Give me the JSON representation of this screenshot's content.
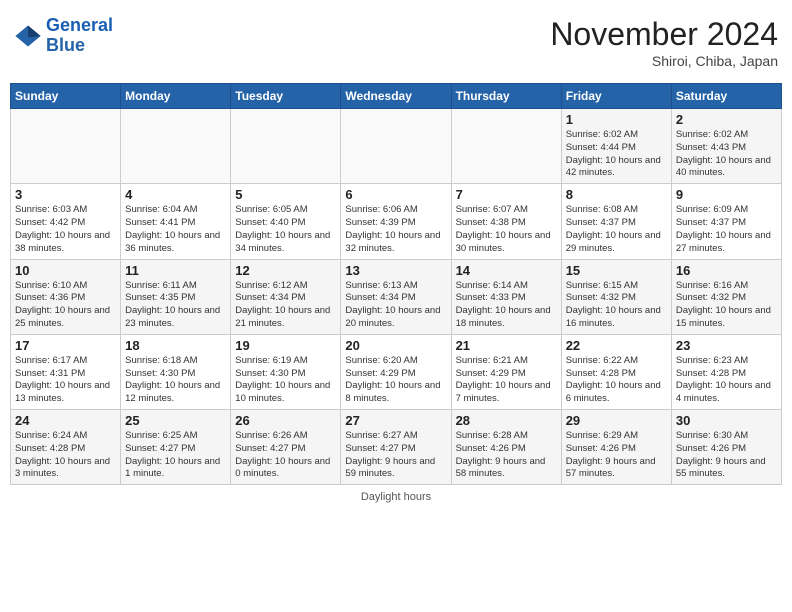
{
  "header": {
    "logo_line1": "General",
    "logo_line2": "Blue",
    "month": "November 2024",
    "location": "Shiroi, Chiba, Japan"
  },
  "days_of_week": [
    "Sunday",
    "Monday",
    "Tuesday",
    "Wednesday",
    "Thursday",
    "Friday",
    "Saturday"
  ],
  "weeks": [
    [
      {
        "day": "",
        "info": ""
      },
      {
        "day": "",
        "info": ""
      },
      {
        "day": "",
        "info": ""
      },
      {
        "day": "",
        "info": ""
      },
      {
        "day": "",
        "info": ""
      },
      {
        "day": "1",
        "info": "Sunrise: 6:02 AM\nSunset: 4:44 PM\nDaylight: 10 hours and 42 minutes."
      },
      {
        "day": "2",
        "info": "Sunrise: 6:02 AM\nSunset: 4:43 PM\nDaylight: 10 hours and 40 minutes."
      }
    ],
    [
      {
        "day": "3",
        "info": "Sunrise: 6:03 AM\nSunset: 4:42 PM\nDaylight: 10 hours and 38 minutes."
      },
      {
        "day": "4",
        "info": "Sunrise: 6:04 AM\nSunset: 4:41 PM\nDaylight: 10 hours and 36 minutes."
      },
      {
        "day": "5",
        "info": "Sunrise: 6:05 AM\nSunset: 4:40 PM\nDaylight: 10 hours and 34 minutes."
      },
      {
        "day": "6",
        "info": "Sunrise: 6:06 AM\nSunset: 4:39 PM\nDaylight: 10 hours and 32 minutes."
      },
      {
        "day": "7",
        "info": "Sunrise: 6:07 AM\nSunset: 4:38 PM\nDaylight: 10 hours and 30 minutes."
      },
      {
        "day": "8",
        "info": "Sunrise: 6:08 AM\nSunset: 4:37 PM\nDaylight: 10 hours and 29 minutes."
      },
      {
        "day": "9",
        "info": "Sunrise: 6:09 AM\nSunset: 4:37 PM\nDaylight: 10 hours and 27 minutes."
      }
    ],
    [
      {
        "day": "10",
        "info": "Sunrise: 6:10 AM\nSunset: 4:36 PM\nDaylight: 10 hours and 25 minutes."
      },
      {
        "day": "11",
        "info": "Sunrise: 6:11 AM\nSunset: 4:35 PM\nDaylight: 10 hours and 23 minutes."
      },
      {
        "day": "12",
        "info": "Sunrise: 6:12 AM\nSunset: 4:34 PM\nDaylight: 10 hours and 21 minutes."
      },
      {
        "day": "13",
        "info": "Sunrise: 6:13 AM\nSunset: 4:34 PM\nDaylight: 10 hours and 20 minutes."
      },
      {
        "day": "14",
        "info": "Sunrise: 6:14 AM\nSunset: 4:33 PM\nDaylight: 10 hours and 18 minutes."
      },
      {
        "day": "15",
        "info": "Sunrise: 6:15 AM\nSunset: 4:32 PM\nDaylight: 10 hours and 16 minutes."
      },
      {
        "day": "16",
        "info": "Sunrise: 6:16 AM\nSunset: 4:32 PM\nDaylight: 10 hours and 15 minutes."
      }
    ],
    [
      {
        "day": "17",
        "info": "Sunrise: 6:17 AM\nSunset: 4:31 PM\nDaylight: 10 hours and 13 minutes."
      },
      {
        "day": "18",
        "info": "Sunrise: 6:18 AM\nSunset: 4:30 PM\nDaylight: 10 hours and 12 minutes."
      },
      {
        "day": "19",
        "info": "Sunrise: 6:19 AM\nSunset: 4:30 PM\nDaylight: 10 hours and 10 minutes."
      },
      {
        "day": "20",
        "info": "Sunrise: 6:20 AM\nSunset: 4:29 PM\nDaylight: 10 hours and 8 minutes."
      },
      {
        "day": "21",
        "info": "Sunrise: 6:21 AM\nSunset: 4:29 PM\nDaylight: 10 hours and 7 minutes."
      },
      {
        "day": "22",
        "info": "Sunrise: 6:22 AM\nSunset: 4:28 PM\nDaylight: 10 hours and 6 minutes."
      },
      {
        "day": "23",
        "info": "Sunrise: 6:23 AM\nSunset: 4:28 PM\nDaylight: 10 hours and 4 minutes."
      }
    ],
    [
      {
        "day": "24",
        "info": "Sunrise: 6:24 AM\nSunset: 4:28 PM\nDaylight: 10 hours and 3 minutes."
      },
      {
        "day": "25",
        "info": "Sunrise: 6:25 AM\nSunset: 4:27 PM\nDaylight: 10 hours and 1 minute."
      },
      {
        "day": "26",
        "info": "Sunrise: 6:26 AM\nSunset: 4:27 PM\nDaylight: 10 hours and 0 minutes."
      },
      {
        "day": "27",
        "info": "Sunrise: 6:27 AM\nSunset: 4:27 PM\nDaylight: 9 hours and 59 minutes."
      },
      {
        "day": "28",
        "info": "Sunrise: 6:28 AM\nSunset: 4:26 PM\nDaylight: 9 hours and 58 minutes."
      },
      {
        "day": "29",
        "info": "Sunrise: 6:29 AM\nSunset: 4:26 PM\nDaylight: 9 hours and 57 minutes."
      },
      {
        "day": "30",
        "info": "Sunrise: 6:30 AM\nSunset: 4:26 PM\nDaylight: 9 hours and 55 minutes."
      }
    ]
  ],
  "legend": {
    "daylight_hours": "Daylight hours"
  }
}
